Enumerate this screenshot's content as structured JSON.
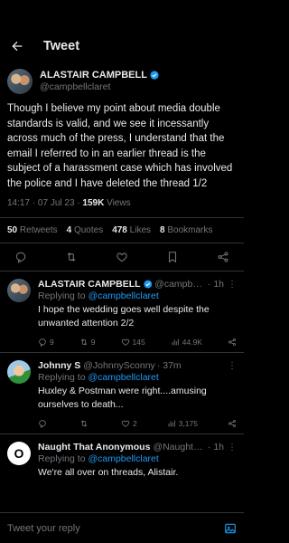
{
  "header": {
    "title": "Tweet"
  },
  "main_tweet": {
    "author_name": "ALASTAIR CAMPBELL",
    "author_handle": "@campbellclaret",
    "text": "Though I believe my point about media double standards is valid, and we see it incessantly across much of the press, I understand that the email I referred to in an earlier thread is the subject of a harassment case which has involved the police and I have deleted the thread 1/2",
    "time": "14:17",
    "date": "07 Jul 23",
    "views_count": "159K",
    "views_label": "Views",
    "stats": {
      "retweets_count": "50",
      "retweets_label": "Retweets",
      "quotes_count": "4",
      "quotes_label": "Quotes",
      "likes_count": "478",
      "likes_label": "Likes",
      "bookmarks_count": "8",
      "bookmarks_label": "Bookmarks"
    }
  },
  "replies": [
    {
      "name": "ALASTAIR CAMPBELL",
      "handle": "@campbel...",
      "time": "· 1h",
      "replying_prefix": "Replying to",
      "replying_to": "@campbellclaret",
      "text": "I hope the wedding goes well despite the unwanted attention 2/2",
      "reply_count": "9",
      "retweet_count": "9",
      "like_count": "145",
      "views": "44.9K"
    },
    {
      "name": "Johnny S",
      "handle": "@JohnnySconny",
      "time": "· 37m",
      "replying_prefix": "Replying to",
      "replying_to": "@campbellclaret",
      "text": "Huxley & Postman were right....amusing ourselves to death...",
      "reply_count": "",
      "retweet_count": "",
      "like_count": "2",
      "views": "3,175"
    },
    {
      "name": "Naught That Anonymous",
      "handle": "@NaughtF...",
      "time": "· 1h",
      "replying_prefix": "Replying to",
      "replying_to": "@campbellclaret",
      "text": "We're all over on threads, Alistair.",
      "avatar_letter": "O"
    }
  ],
  "composer": {
    "placeholder": "Tweet your reply"
  },
  "colors": {
    "accent": "#1d9bf0",
    "background": "#000000",
    "muted": "#71767b",
    "divider": "#2f3336"
  }
}
